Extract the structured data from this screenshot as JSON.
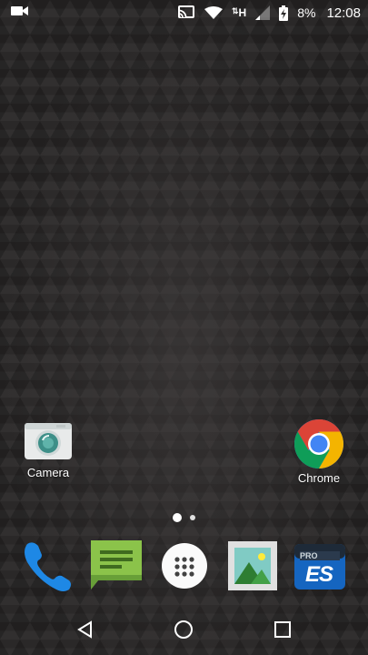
{
  "status_bar": {
    "battery_percent": "8%",
    "time": "12:08",
    "network_label": "H",
    "icons": [
      "video-call-icon",
      "cast-icon",
      "wifi-icon",
      "data-h-icon",
      "signal-icon",
      "battery-charging-icon"
    ]
  },
  "home_apps": [
    {
      "label": "Camera",
      "icon": "camera-icon"
    },
    {
      "label": "Chrome",
      "icon": "chrome-icon"
    }
  ],
  "page_indicator": {
    "pages": 2,
    "current": 1
  },
  "dock": [
    {
      "icon": "phone-icon"
    },
    {
      "icon": "messaging-icon"
    },
    {
      "icon": "app-drawer-icon"
    },
    {
      "icon": "gallery-icon"
    },
    {
      "icon": "es-file-explorer-icon",
      "badge": "PRO",
      "logo": "ES"
    }
  ],
  "nav_bar": [
    "back-icon",
    "home-icon",
    "recents-icon"
  ],
  "colors": {
    "phone": "#1e88e5",
    "messaging": "#8bc34a",
    "gallery_bg": "#e0e0e0",
    "chrome_red": "#db4437",
    "chrome_green": "#0f9d58",
    "chrome_yellow": "#f4b400",
    "chrome_blue": "#4285f4"
  }
}
